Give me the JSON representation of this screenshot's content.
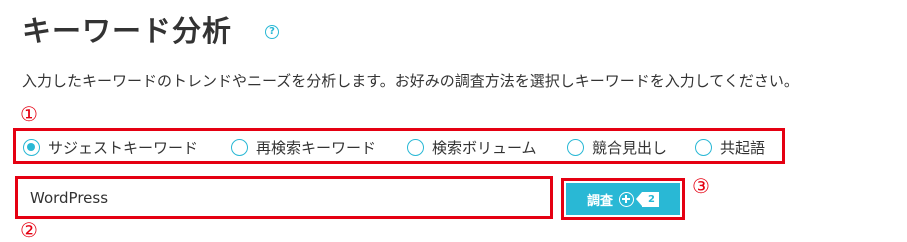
{
  "page": {
    "title": "キーワード分析",
    "help_symbol": "?",
    "description": "入力したキーワードのトレンドやニーズを分析します。お好みの調査方法を選択しキーワードを入力してください。"
  },
  "annotations": {
    "one": "①",
    "two": "②",
    "three": "③"
  },
  "radio_options": {
    "selected": "サジェストキーワード",
    "items": [
      {
        "label": "サジェストキーワード",
        "checked": true
      },
      {
        "label": "再検索キーワード",
        "checked": false
      },
      {
        "label": "検索ボリューム",
        "checked": false
      },
      {
        "label": "競合見出し",
        "checked": false
      },
      {
        "label": "共起語",
        "checked": false
      }
    ]
  },
  "keyword_input": {
    "value": "WordPress"
  },
  "search_button": {
    "label": "調査",
    "credit_count": "2"
  },
  "colors": {
    "accent": "#29b8d5",
    "highlight_red": "#e50012",
    "text": "#333333"
  },
  "icons": {
    "help": "question-circle-icon",
    "add": "plus-circle-icon",
    "credit": "tag-icon"
  }
}
